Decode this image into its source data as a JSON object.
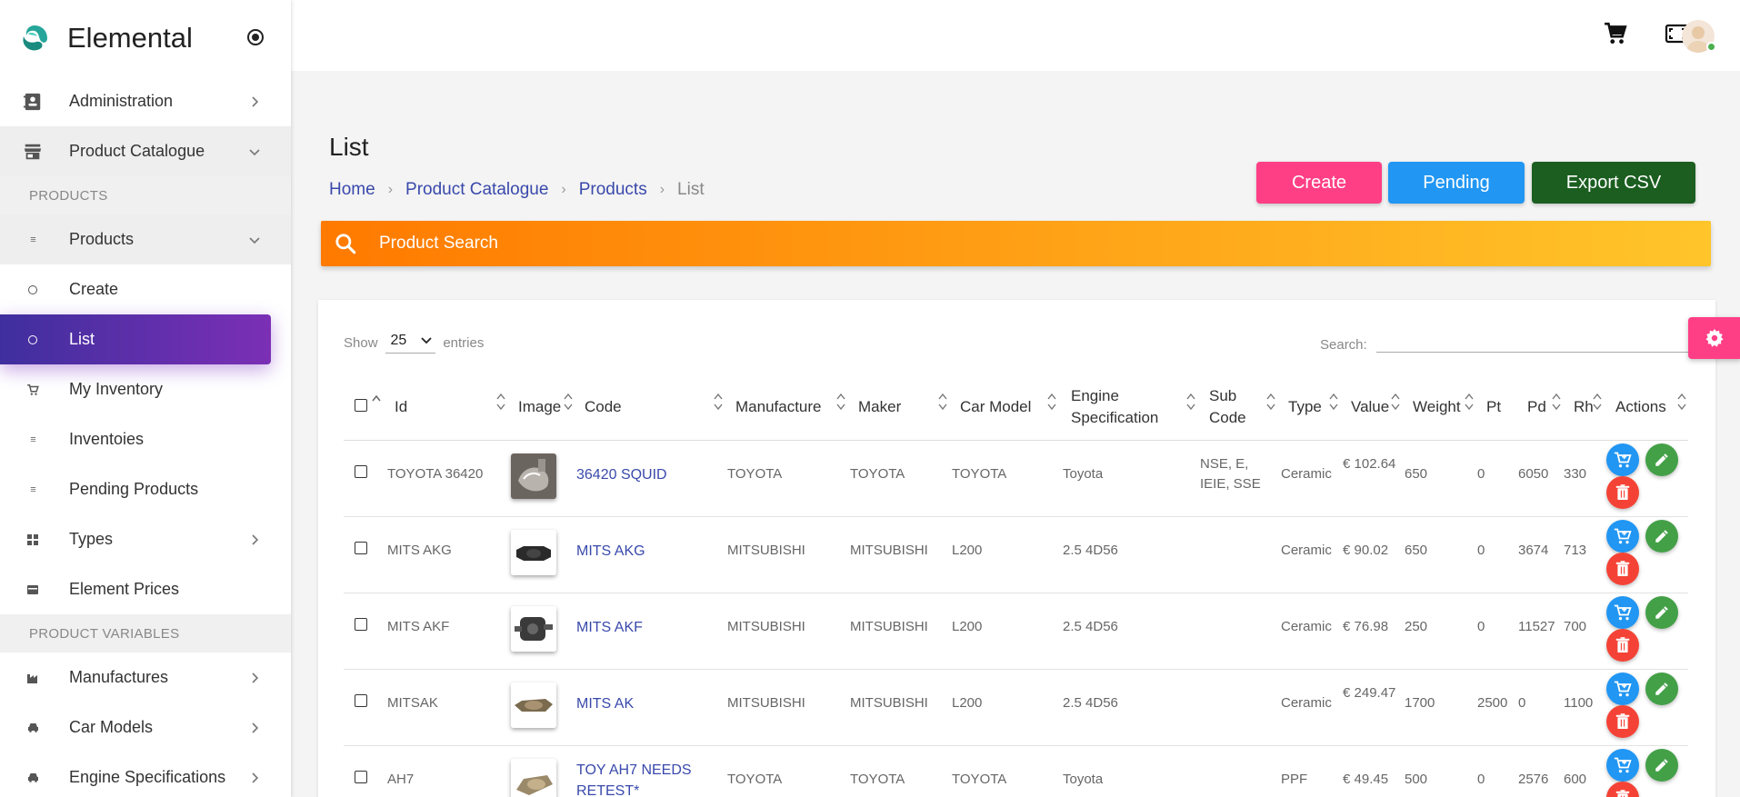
{
  "app": {
    "name": "Elemental"
  },
  "sidebar": {
    "items": [
      {
        "label": "Administration"
      },
      {
        "label": "Product Catalogue"
      },
      {
        "section": "PRODUCTS"
      },
      {
        "label": "Products"
      },
      {
        "label": "Create"
      },
      {
        "label": "List"
      },
      {
        "label": "My Inventory"
      },
      {
        "label": "Inventoies"
      },
      {
        "label": "Pending Products"
      },
      {
        "label": "Types"
      },
      {
        "label": "Element Prices"
      },
      {
        "section": "PRODUCT VARIABLES"
      },
      {
        "label": "Manufactures"
      },
      {
        "label": "Car Models"
      },
      {
        "label": "Engine Specifications"
      }
    ]
  },
  "page": {
    "title": "List",
    "breadcrumb": [
      "Home",
      "Product Catalogue",
      "Products",
      "List"
    ],
    "buttons": {
      "create": "Create",
      "pending": "Pending",
      "export": "Export CSV"
    },
    "product_search_placeholder": "Product Search"
  },
  "table_controls": {
    "show": "Show",
    "entries_value": "25",
    "entries": "entries",
    "search_label": "Search:"
  },
  "table": {
    "headers": [
      "Id",
      "Image",
      "Code",
      "Manufacture",
      "Maker",
      "Car Model",
      "Engine Specification",
      "Sub Code",
      "Type",
      "Value",
      "Weight",
      "Pt",
      "Pd",
      "Rh",
      "Actions"
    ],
    "rows": [
      {
        "id": "TOYOTA 36420",
        "code": "36420 SQUID",
        "manufacture": "TOYOTA",
        "maker": "TOYOTA",
        "car_model": "TOYOTA",
        "engine": "Toyota",
        "sub_code": "NSE, E, IEIE, SSE",
        "type": "Ceramic",
        "value": "€ 102.64",
        "weight": "650",
        "pt": "0",
        "pd": "6050",
        "rh": "330"
      },
      {
        "id": "MITS AKG",
        "code": "MITS AKG",
        "manufacture": "MITSUBISHI",
        "maker": "MITSUBISHI",
        "car_model": "L200",
        "engine": "2.5 4D56",
        "sub_code": "",
        "type": "Ceramic",
        "value": "€ 90.02",
        "weight": "650",
        "pt": "0",
        "pd": "3674",
        "rh": "713"
      },
      {
        "id": "MITS AKF",
        "code": "MITS AKF",
        "manufacture": "MITSUBISHI",
        "maker": "MITSUBISHI",
        "car_model": "L200",
        "engine": "2.5 4D56",
        "sub_code": "",
        "type": "Ceramic",
        "value": "€ 76.98",
        "weight": "250",
        "pt": "0",
        "pd": "11527",
        "rh": "700"
      },
      {
        "id": "MITSAK",
        "code": "MITS AK",
        "manufacture": "MITSUBISHI",
        "maker": "MITSUBISHI",
        "car_model": "L200",
        "engine": "2.5 4D56",
        "sub_code": "",
        "type": "Ceramic",
        "value": "€ 249.47",
        "weight": "1700",
        "pt": "2500",
        "pd": "0",
        "rh": "1100"
      },
      {
        "id": "AH7",
        "code": "TOY AH7 NEEDS RETEST*",
        "manufacture": "TOYOTA",
        "maker": "TOYOTA",
        "car_model": "TOYOTA",
        "engine": "Toyota",
        "sub_code": "",
        "type": "PPF",
        "value": "€ 49.45",
        "weight": "500",
        "pt": "0",
        "pd": "2576",
        "rh": "600"
      }
    ]
  },
  "colors": {
    "create": "#ff3f85",
    "pending": "#2196f3",
    "export": "#1b5e20",
    "active_nav_start": "#3f2f9e",
    "active_nav_end": "#7b2fb5",
    "search_start": "#ff7a00",
    "search_end": "#ffc52a"
  }
}
